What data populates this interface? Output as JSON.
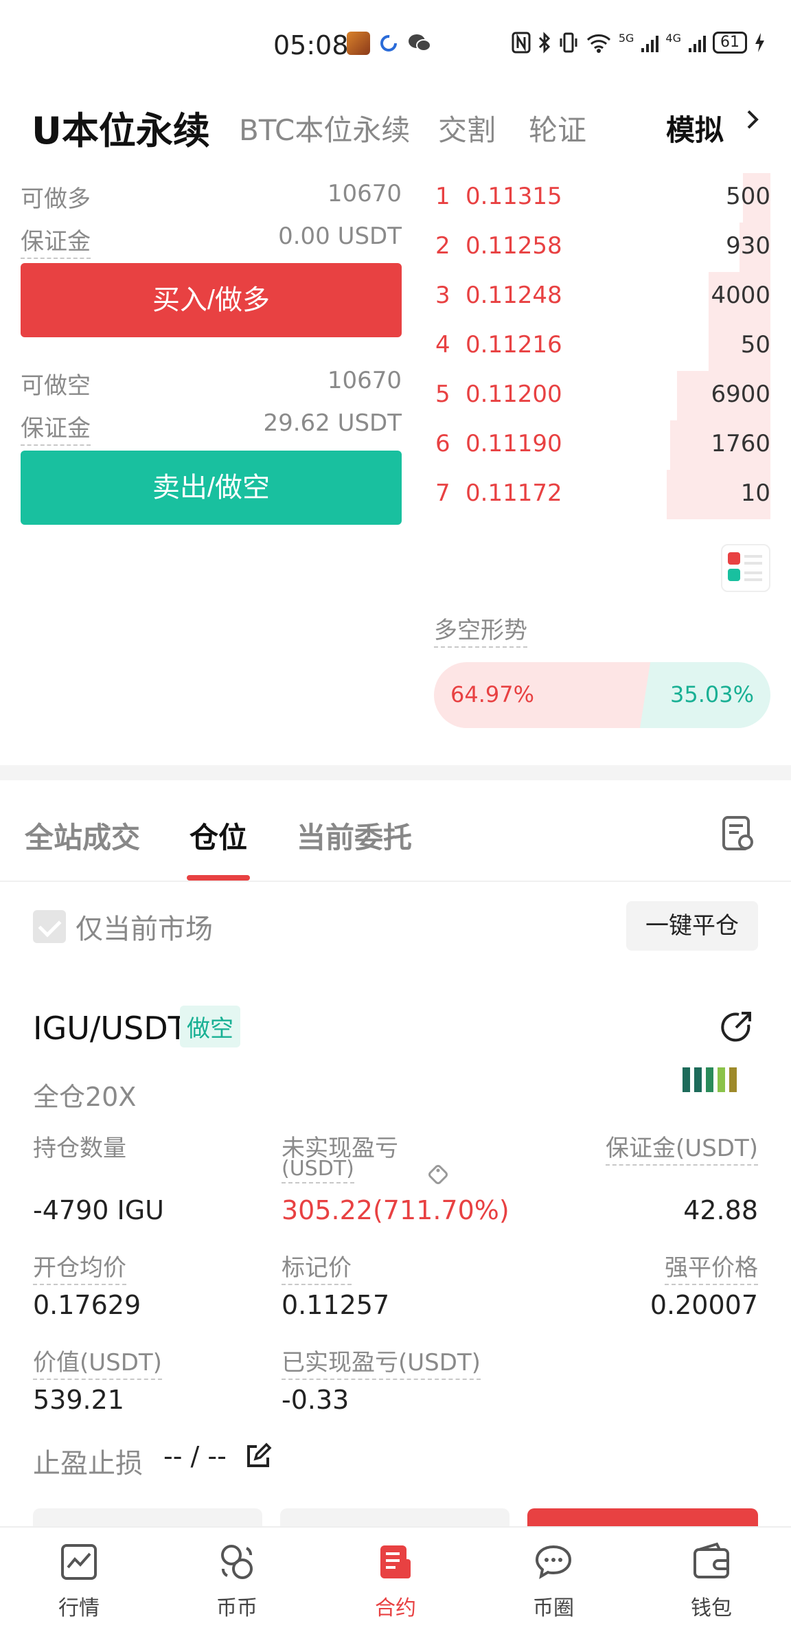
{
  "status_bar": {
    "time": "05:08",
    "network_5g": "5G",
    "network_4g": "4G",
    "battery": "61"
  },
  "top_tabs": [
    {
      "label": "U本位永续",
      "active": true
    },
    {
      "label": "BTC本位永续",
      "active": false
    },
    {
      "label": "交割",
      "active": false
    },
    {
      "label": "轮证",
      "active": false
    },
    {
      "label": "模拟",
      "active": false
    }
  ],
  "trade_panel": {
    "long_available_label": "可做多",
    "long_available_value": "10670",
    "long_margin_label": "保证金",
    "long_margin_value": "0.00 USDT",
    "buy_button": "买入/做多",
    "short_available_label": "可做空",
    "short_available_value": "10670",
    "short_margin_label": "保证金",
    "short_margin_value": "29.62 USDT",
    "sell_button": "卖出/做空"
  },
  "order_book": [
    {
      "index": "1",
      "price": "0.11315",
      "qty": "500",
      "depth": 0.08
    },
    {
      "index": "2",
      "price": "0.11258",
      "qty": "930",
      "depth": 0.09
    },
    {
      "index": "3",
      "price": "0.11248",
      "qty": "4000",
      "depth": 0.18
    },
    {
      "index": "4",
      "price": "0.11216",
      "qty": "50",
      "depth": 0.18
    },
    {
      "index": "5",
      "price": "0.11200",
      "qty": "6900",
      "depth": 0.27
    },
    {
      "index": "6",
      "price": "0.11190",
      "qty": "1760",
      "depth": 0.29
    },
    {
      "index": "7",
      "price": "0.11172",
      "qty": "10",
      "depth": 0.3
    }
  ],
  "sentiment": {
    "title": "多空形势",
    "long_pct": "64.97%",
    "short_pct": "35.03%",
    "long_fraction": 0.6497
  },
  "bottom_tabs": [
    {
      "label": "全站成交",
      "active": false
    },
    {
      "label": "仓位",
      "active": true
    },
    {
      "label": "当前委托",
      "active": false
    }
  ],
  "filter": {
    "only_current_market": "仅当前市场",
    "close_all_button": "一键平仓"
  },
  "position": {
    "pair": "IGU/USDT",
    "side": "做空",
    "margin_mode": "全仓20X",
    "qty_label": "持仓数量",
    "qty_value": "-4790 IGU",
    "pnl_label": "未实现盈亏",
    "pnl_unit": "(USDT)",
    "pnl_value": "305.22(711.70%)",
    "margin_label": "保证金(USDT)",
    "margin_value": "42.88",
    "entry_label": "开仓均价",
    "entry_value": "0.17629",
    "mark_label": "标记价",
    "mark_value": "0.11257",
    "liq_label": "强平价格",
    "liq_value": "0.20007",
    "value_label": "价值(USDT)",
    "value_value": "539.21",
    "realized_label": "已实现盈亏(USDT)",
    "realized_value": "-0.33",
    "tpsl_label": "止盈止损",
    "tpsl_value": "-- / --"
  },
  "nav": [
    {
      "label": "行情",
      "icon": "chart-icon",
      "active": false
    },
    {
      "label": "币币",
      "icon": "coins-icon",
      "active": false
    },
    {
      "label": "合约",
      "icon": "contract-icon",
      "active": true
    },
    {
      "label": "币圈",
      "icon": "chat-icon",
      "active": false
    },
    {
      "label": "钱包",
      "icon": "wallet-icon",
      "active": false
    }
  ],
  "colors": {
    "red": "#e84142",
    "green": "#19c09f"
  }
}
